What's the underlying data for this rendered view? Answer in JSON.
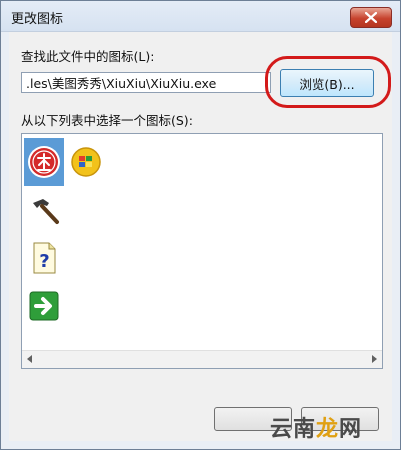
{
  "window": {
    "title": "更改图标"
  },
  "lookup": {
    "label": "查找此文件中的图标(L):",
    "path_value": ".les\\美图秀秀\\XiuXiu\\XiuXiu.exe",
    "browse_label": "浏览(B)..."
  },
  "list": {
    "label": "从以下列表中选择一个图标(S):",
    "icons": [
      "xiuxiu-app-icon",
      "colorful-ball-icon",
      "hammer-icon",
      "help-document-icon",
      "green-arrow-icon"
    ],
    "selected_index": 0
  },
  "watermark": {
    "part1": "云南",
    "part2": "龙",
    "part3": "网"
  },
  "colors": {
    "selection": "#5b9bd6",
    "highlight_ring": "#d31a1a",
    "close_button": "#c7432e"
  }
}
